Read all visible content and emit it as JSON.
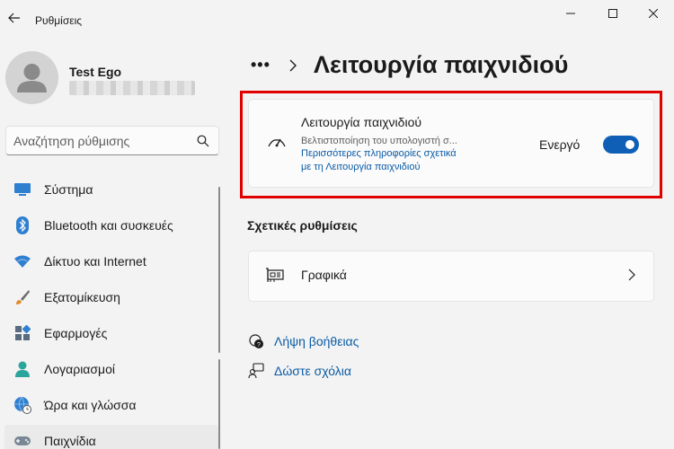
{
  "app": {
    "title": "Ρυθμίσεις"
  },
  "user": {
    "name": "Test Ego"
  },
  "search": {
    "placeholder": "Αναζήτηση ρύθμισης"
  },
  "sidebar": {
    "items": [
      {
        "label": "Σύστημα",
        "icon": "system-icon"
      },
      {
        "label": "Bluetooth και συσκευές",
        "icon": "bluetooth-icon"
      },
      {
        "label": "Δίκτυο και Internet",
        "icon": "wifi-icon"
      },
      {
        "label": "Εξατομίκευση",
        "icon": "brush-icon"
      },
      {
        "label": "Εφαρμογές",
        "icon": "apps-icon"
      },
      {
        "label": "Λογαριασμοί",
        "icon": "account-icon"
      },
      {
        "label": "Ώρα και γλώσσα",
        "icon": "globe-clock-icon"
      },
      {
        "label": "Παιχνίδια",
        "icon": "gamepad-icon",
        "selected": true
      }
    ]
  },
  "breadcrumb": {
    "more": "•••",
    "current": "Λειτουργία παιχνιδιού"
  },
  "game_mode": {
    "title": "Λειτουργία παιχνιδιού",
    "description": "Βελτιστοποίηση του υπολογιστή σ...",
    "link_line1": "Περισσότερες πληροφορίες σχετικά",
    "link_line2": "με τη Λειτουργία παιχνιδιού",
    "state_label": "Ενεργό",
    "enabled": true
  },
  "related": {
    "header": "Σχετικές ρυθμίσεις",
    "graphics_label": "Γραφικά"
  },
  "help": {
    "get_help": "Λήψη βοήθειας",
    "feedback": "Δώστε σχόλια"
  },
  "colors": {
    "accent": "#0f5fb7",
    "link": "#0a5ba6",
    "highlight": "#e00000"
  }
}
